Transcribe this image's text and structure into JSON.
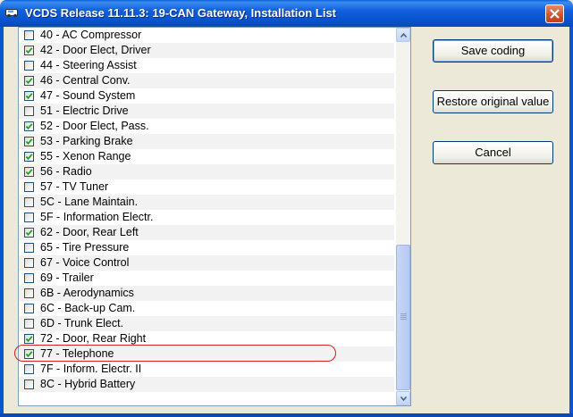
{
  "window": {
    "title": "VCDS Release 11.11.3: 19-CAN Gateway,  Installation List",
    "close_label": "✕"
  },
  "list": {
    "items": [
      {
        "label": "40 - AC Compressor",
        "checked": false
      },
      {
        "label": "42 - Door Elect, Driver",
        "checked": true
      },
      {
        "label": "44 - Steering Assist",
        "checked": false
      },
      {
        "label": "46 - Central Conv.",
        "checked": true
      },
      {
        "label": "47 - Sound System",
        "checked": true
      },
      {
        "label": "51 - Electric Drive",
        "checked": false
      },
      {
        "label": "52 - Door Elect, Pass.",
        "checked": true
      },
      {
        "label": "53 - Parking Brake",
        "checked": true
      },
      {
        "label": "55 - Xenon Range",
        "checked": true
      },
      {
        "label": "56 - Radio",
        "checked": true
      },
      {
        "label": "57 - TV Tuner",
        "checked": false
      },
      {
        "label": "5C - Lane Maintain.",
        "checked": false
      },
      {
        "label": "5F - Information Electr.",
        "checked": false
      },
      {
        "label": "62 - Door, Rear Left",
        "checked": true
      },
      {
        "label": "65 - Tire Pressure",
        "checked": false
      },
      {
        "label": "67 - Voice Control",
        "checked": false
      },
      {
        "label": "69 - Trailer",
        "checked": false
      },
      {
        "label": "6B - Aerodynamics",
        "checked": false
      },
      {
        "label": "6C - Back-up Cam.",
        "checked": false
      },
      {
        "label": "6D - Trunk Elect.",
        "checked": false
      },
      {
        "label": "72 - Door, Rear Right",
        "checked": true
      },
      {
        "label": "77 - Telephone",
        "checked": true
      },
      {
        "label": "7F - Inform. Electr. II",
        "checked": false
      },
      {
        "label": "8C - Hybrid Battery",
        "checked": false
      }
    ],
    "highlighted_item": "77 - Telephone"
  },
  "buttons": {
    "save": "Save coding",
    "restore": "Restore original value",
    "cancel": "Cancel"
  },
  "colors": {
    "title_bar": "#0a55d0",
    "highlight_ring": "#d82020",
    "check_mark": "#21a121"
  }
}
